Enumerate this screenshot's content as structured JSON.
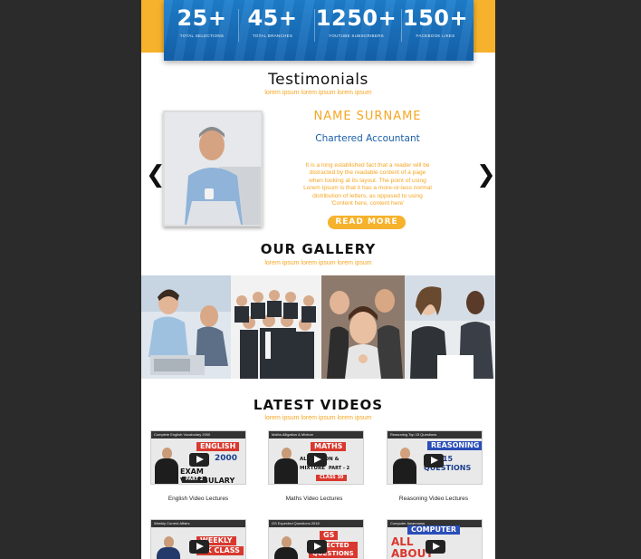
{
  "stats": [
    {
      "value": "25+",
      "label": "TOTAL SELECTIONS"
    },
    {
      "value": "45+",
      "label": "TOTAL BRANCHES"
    },
    {
      "value": "1250+",
      "label": "YOUTUBE SUBSCRIBERS"
    },
    {
      "value": "150+",
      "label": "FACEBOOK LIKES"
    }
  ],
  "testimonials": {
    "title": "Testimonials",
    "subtitle": "lorem ipsum lorem ipsum lorem ipsum",
    "name": "NAME SURNAME",
    "role": "Chartered Accountant",
    "text": "It is a long established fact that a reader will be distracted by the readable content of a page when looking at its layout. The point of using Lorem Ipsum is that it has a more-or-less normal distribution of letters, as opposed to using 'Content here, content here'",
    "read_more": "READ MORE",
    "prev_icon": "❮",
    "next_icon": "❯"
  },
  "gallery": {
    "title": "OUR GALLERY",
    "subtitle": "lorem ipsum lorem ipsum lorem ipsum"
  },
  "videos": {
    "title": "LATEST VIDEOS",
    "subtitle": "lorem ipsum lorem ipsum lorem ipsum",
    "items": [
      {
        "label": "English Video Lectures",
        "tag": "ENGLISH",
        "big": "EXAM VOCABULARY",
        "topbar": "Complete English Vocabulary 2000",
        "num": "2000",
        "part": "PART 2",
        "accent": "#d9382e"
      },
      {
        "label": "Maths Video Lectures",
        "tag": "MATHS",
        "big": "ALLIGATION & MIXTURE",
        "topbar": "Maths Alligation & Mixture",
        "part": "PART - 2",
        "class_no": "CLASS 30",
        "accent": "#d9382e"
      },
      {
        "label": "Reasoning Video Lectures",
        "tag": "REASONING",
        "big": "TOP 15 QUESTIONS",
        "topbar": "Reasoning Top 15 Questions",
        "accent": "#2a4db8"
      },
      {
        "label": "",
        "tag": "WEEKLY",
        "big": "GK CLASS",
        "topbar": "Weekly Current Affairs",
        "accent": "#d9382e"
      },
      {
        "label": "",
        "tag": "GS",
        "big": "EXPECTED QUESTIONS",
        "topbar": "GS Expected Questions 2018",
        "accent": "#d9382e"
      },
      {
        "label": "",
        "tag": "COMPUTER",
        "big": "ALL ABOUT",
        "topbar": "Computer Awareness",
        "accent": "#2a4db8"
      }
    ]
  }
}
